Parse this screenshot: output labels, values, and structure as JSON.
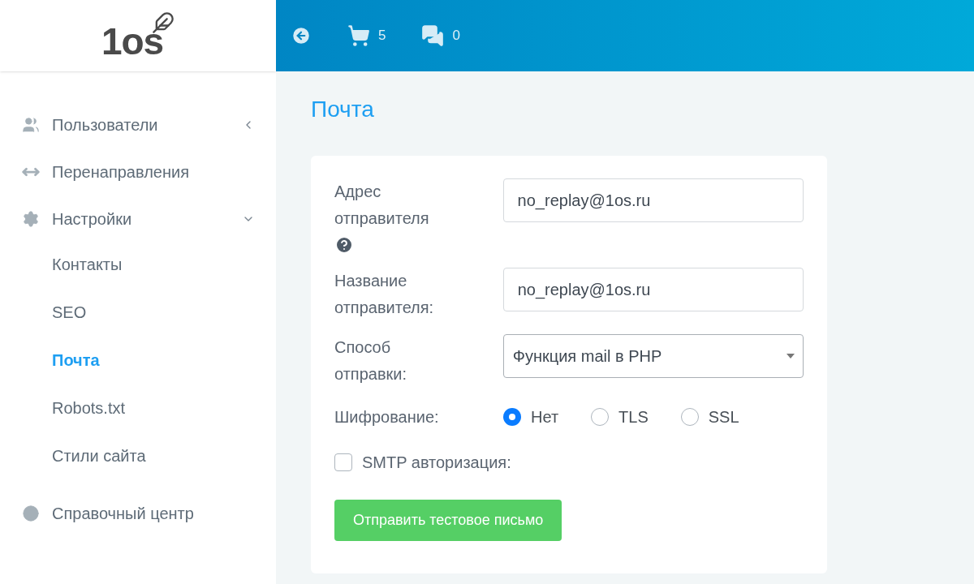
{
  "logo": {
    "text": "1os"
  },
  "header": {
    "cart_count": "5",
    "messages_count": "0"
  },
  "sidebar": {
    "items": [
      {
        "label": "Пользователи",
        "expanded": false
      },
      {
        "label": "Перенаправления"
      },
      {
        "label": "Настройки",
        "expanded": true,
        "children": [
          {
            "label": "Контакты",
            "selected": false
          },
          {
            "label": "SEO",
            "selected": false
          },
          {
            "label": "Почта",
            "selected": true
          },
          {
            "label": "Robots.txt",
            "selected": false
          },
          {
            "label": "Стили сайта",
            "selected": false
          }
        ]
      },
      {
        "label": "Справочный центр"
      }
    ]
  },
  "page": {
    "title": "Почта"
  },
  "form": {
    "sender_address": {
      "label": "Адрес отправителя",
      "value": "no_replay@1os.ru"
    },
    "sender_name": {
      "label": "Название отправителя:",
      "value": "no_replay@1os.ru"
    },
    "send_method": {
      "label": "Способ отправки:",
      "value": "Функция mail в PHP"
    },
    "encryption": {
      "label": "Шифрование:",
      "options": [
        {
          "label": "Нет",
          "selected": true
        },
        {
          "label": "TLS",
          "selected": false
        },
        {
          "label": "SSL",
          "selected": false
        }
      ]
    },
    "smtp_auth": {
      "label": "SMTP авторизация:",
      "checked": false
    },
    "test_button": "Отправить тестовое письмо"
  }
}
